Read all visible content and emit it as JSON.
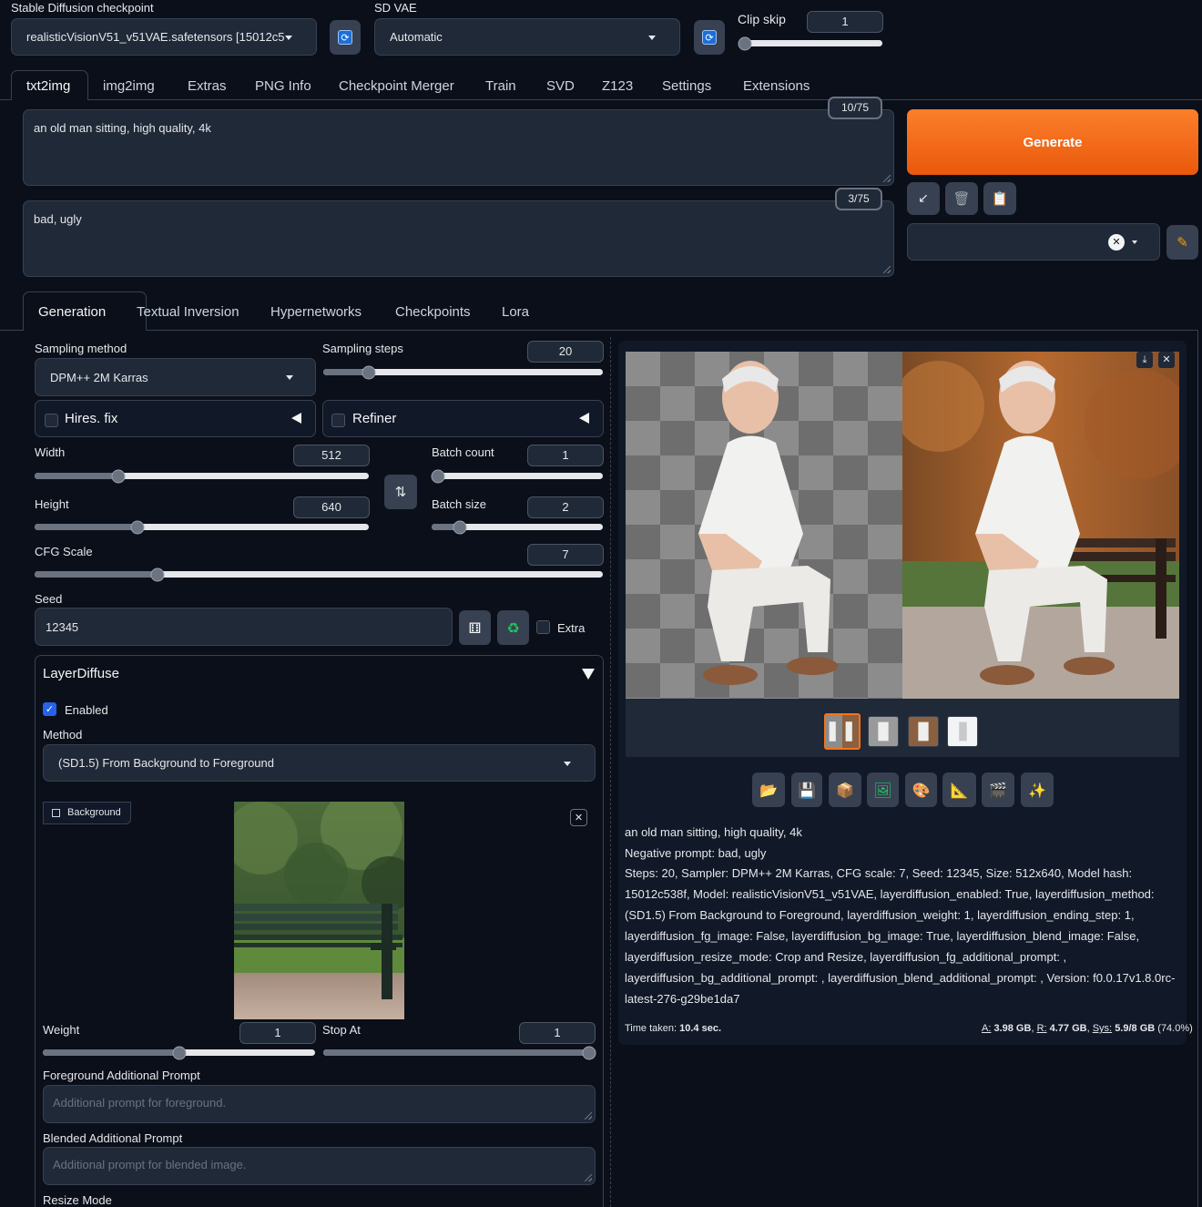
{
  "top": {
    "checkpoint_label": "Stable Diffusion checkpoint",
    "checkpoint_value": "realisticVisionV51_v51VAE.safetensors [15012c5",
    "vae_label": "SD VAE",
    "vae_value": "Automatic",
    "clip_skip_label": "Clip skip",
    "clip_skip_value": "1",
    "clip_skip_fraction": 0
  },
  "tabs": [
    "txt2img",
    "img2img",
    "Extras",
    "PNG Info",
    "Checkpoint Merger",
    "Train",
    "SVD",
    "Z123",
    "Settings",
    "Extensions"
  ],
  "prompt": {
    "positive": "an old man sitting, high quality, 4k",
    "positive_count": "10/75",
    "negative": "bad, ugly",
    "negative_count": "3/75"
  },
  "generate_label": "Generate",
  "subtabs": [
    "Generation",
    "Textual Inversion",
    "Hypernetworks",
    "Checkpoints",
    "Lora"
  ],
  "generation": {
    "sampling_method_label": "Sampling method",
    "sampling_method_value": "DPM++ 2M Karras",
    "sampling_steps_label": "Sampling steps",
    "sampling_steps_value": "20",
    "sampling_steps_fraction": 0.147,
    "hires_fix_label": "Hires. fix",
    "refiner_label": "Refiner",
    "width_label": "Width",
    "width_value": "512",
    "width_fraction": 0.24,
    "height_label": "Height",
    "height_value": "640",
    "height_fraction": 0.3,
    "batch_count_label": "Batch count",
    "batch_count_value": "1",
    "batch_count_fraction": 0,
    "batch_size_label": "Batch size",
    "batch_size_value": "2",
    "batch_size_fraction": 0.14,
    "cfg_label": "CFG Scale",
    "cfg_value": "7",
    "cfg_fraction": 0.21,
    "seed_label": "Seed",
    "seed_value": "12345",
    "extra_label": "Extra"
  },
  "layerdiffuse": {
    "title": "LayerDiffuse",
    "enabled_label": "Enabled",
    "method_label": "Method",
    "method_value": "(SD1.5) From Background to Foreground",
    "background_label": "Background",
    "weight_label": "Weight",
    "weight_value": "1",
    "weight_fraction": 0.5,
    "stop_at_label": "Stop At",
    "stop_at_value": "1",
    "stop_at_fraction": 1.0,
    "fg_prompt_label": "Foreground Additional Prompt",
    "fg_prompt_placeholder": "Additional prompt for foreground.",
    "blend_prompt_label": "Blended Additional Prompt",
    "blend_prompt_placeholder": "Additional prompt for blended image.",
    "resize_mode_label": "Resize Mode"
  },
  "output": {
    "info_line1": "an old man sitting, high quality, 4k",
    "info_line2": "Negative prompt: bad, ugly",
    "info_params": "Steps: 20, Sampler: DPM++ 2M Karras, CFG scale: 7, Seed: 12345, Size: 512x640, Model hash: 15012c538f, Model: realisticVisionV51_v51VAE, layerdiffusion_enabled: True, layerdiffusion_method: (SD1.5) From Background to Foreground, layerdiffusion_weight: 1, layerdiffusion_ending_step: 1, layerdiffusion_fg_image: False, layerdiffusion_bg_image: True, layerdiffusion_blend_image: False, layerdiffusion_resize_mode: Crop and Resize, layerdiffusion_fg_additional_prompt: , layerdiffusion_bg_additional_prompt: , layerdiffusion_blend_additional_prompt: , Version: f0.0.17v1.8.0rc-latest-276-g29be1da7",
    "time_label": "Time taken:",
    "time_value": "10.4 sec.",
    "mem_a_label": "A:",
    "mem_a": "3.98 GB",
    "mem_r_label": "R:",
    "mem_r": "4.77 GB",
    "mem_sys_label": "Sys:",
    "mem_sys": "5.9/8 GB",
    "mem_pct": "(74.0%)"
  },
  "icons": {
    "refresh": "refresh-icon",
    "arrow": "arrow-icon",
    "trash": "trash-icon",
    "clipboard": "clipboard-icon",
    "pencil": "pencil-icon",
    "dice": "dice-icon",
    "recycle": "recycle-icon",
    "swap": "swap-icon"
  },
  "colors": {
    "accent": "#f97316",
    "background": "#0b0f19",
    "panel": "#1f2937"
  }
}
